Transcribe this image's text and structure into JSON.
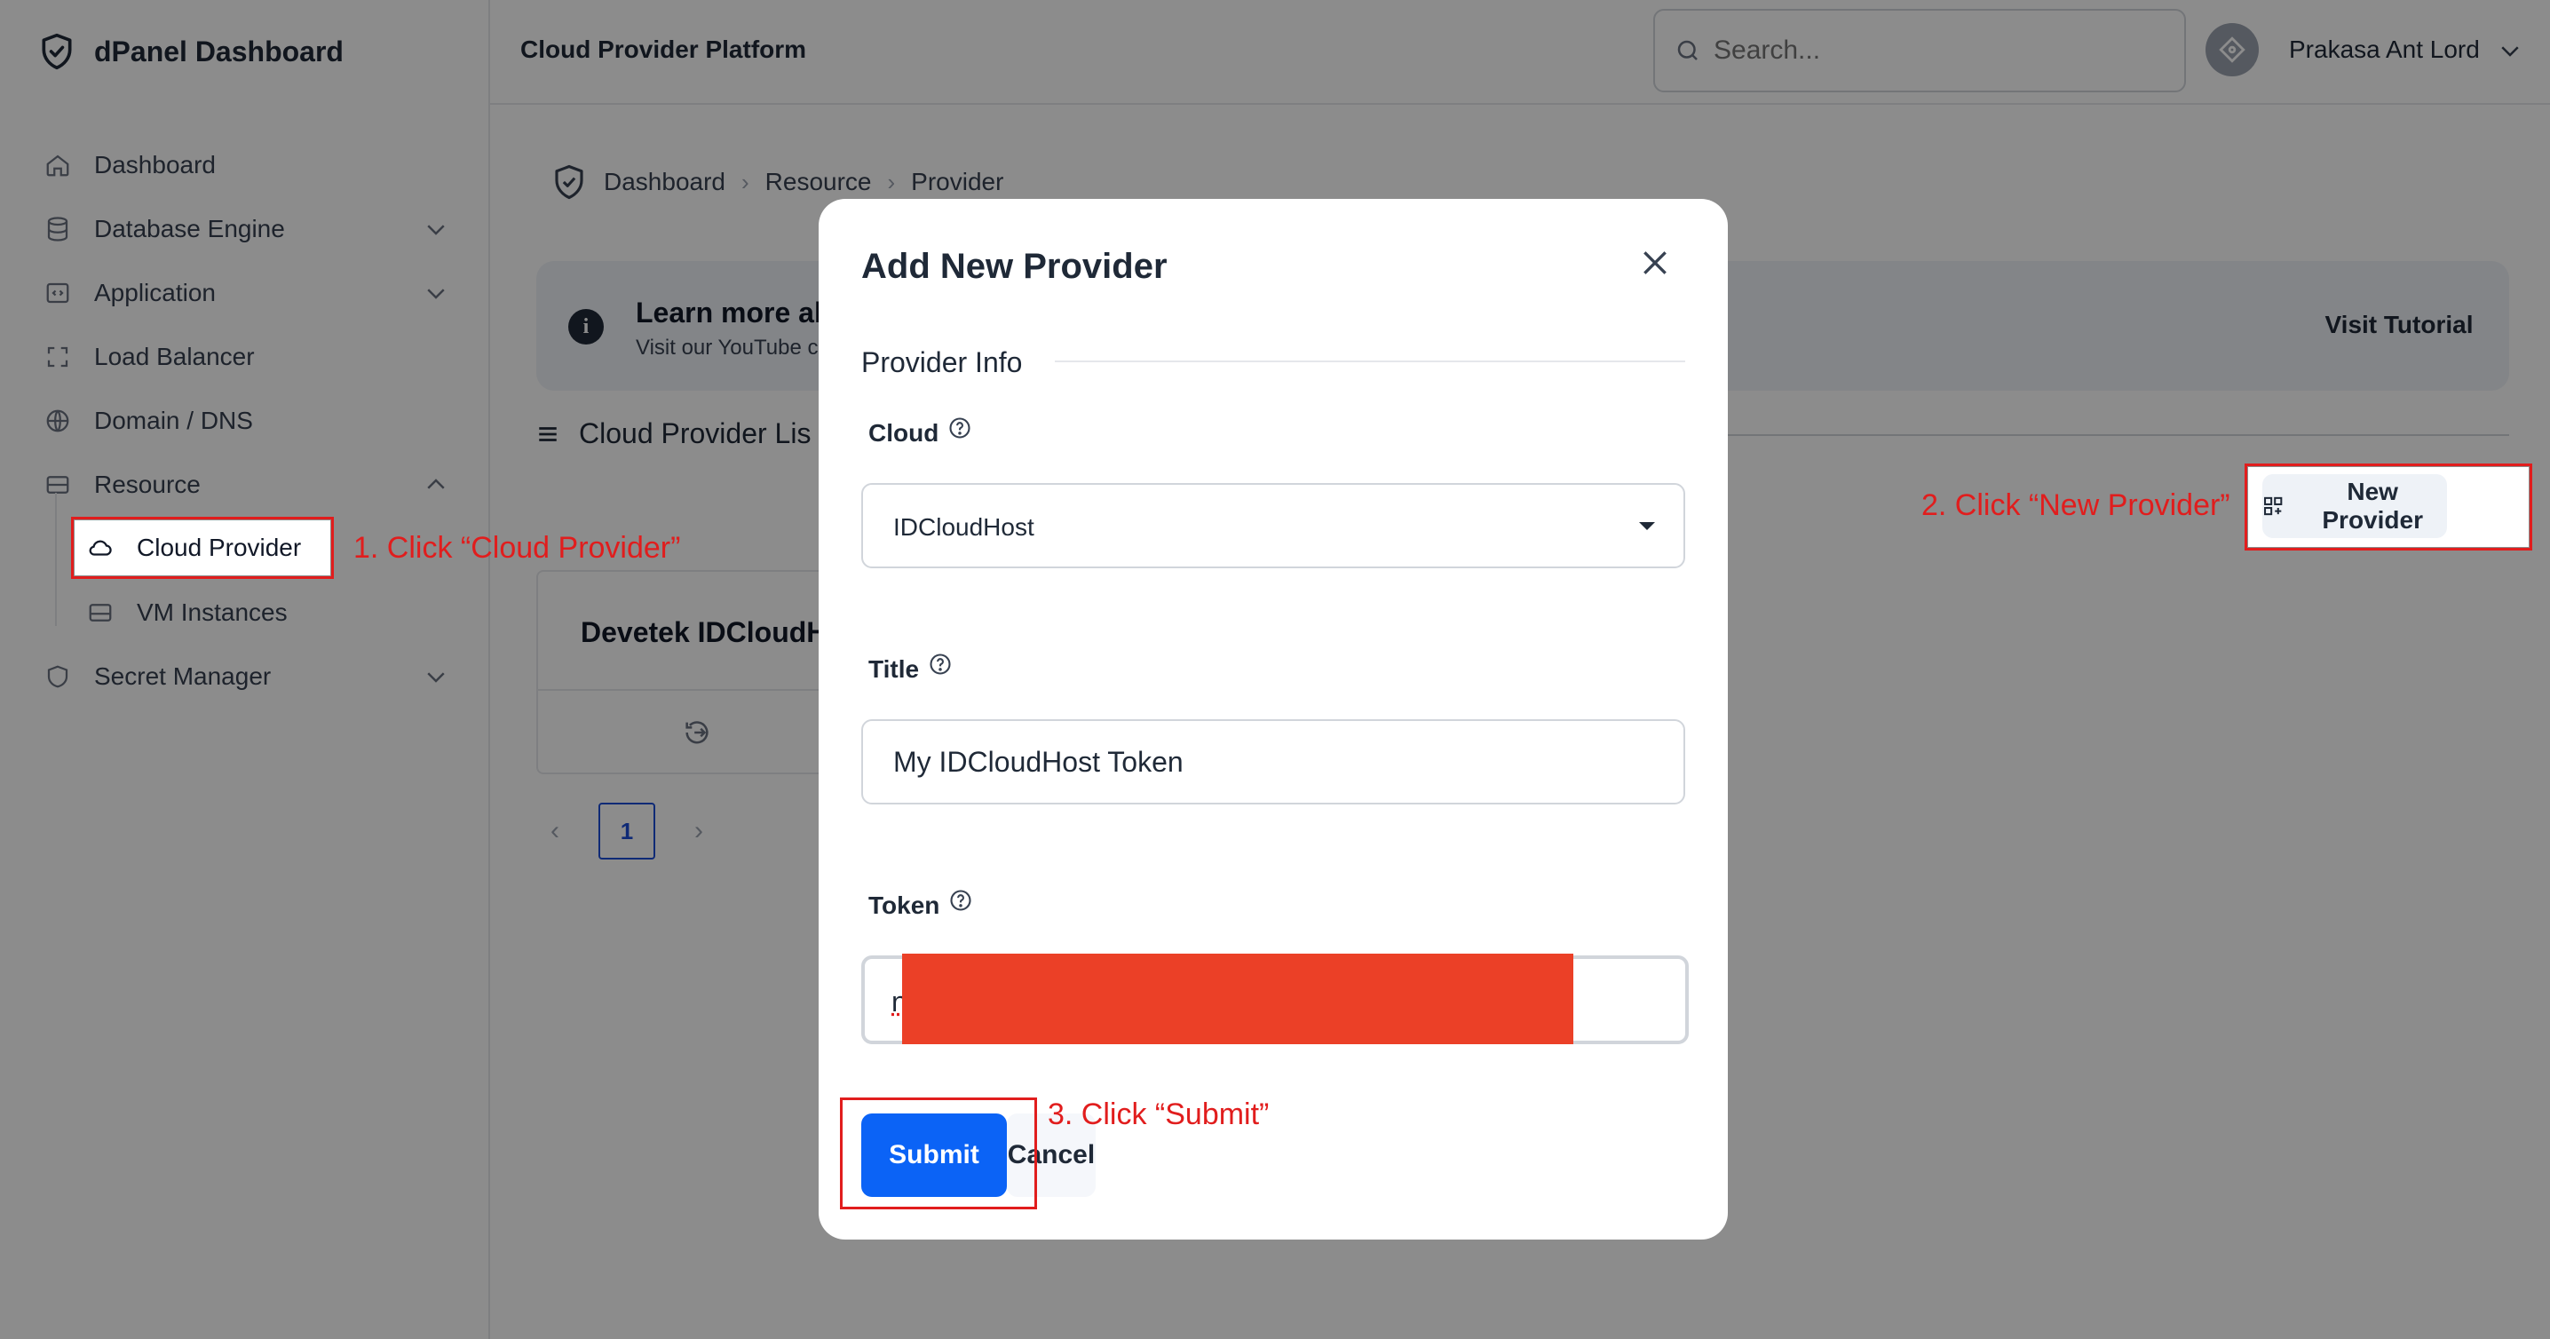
{
  "brand": {
    "title": "dPanel Dashboard",
    "icon": "shield-check-icon"
  },
  "topbar": {
    "title": "Cloud Provider Platform",
    "search_placeholder": "Search...",
    "user_name": "Prakasa Ant Lord"
  },
  "sidebar": {
    "items": [
      {
        "label": "Dashboard",
        "icon": "home-icon"
      },
      {
        "label": "Database Engine",
        "icon": "database-icon"
      },
      {
        "label": "Application",
        "icon": "code-window-icon"
      },
      {
        "label": "Load Balancer",
        "icon": "expand-icon"
      },
      {
        "label": "Domain / DNS",
        "icon": "globe-icon"
      },
      {
        "label": "Resource",
        "icon": "server-icon"
      },
      {
        "label": "Secret Manager",
        "icon": "shield-icon"
      }
    ],
    "resource_children": [
      {
        "label": "Cloud Provider",
        "icon": "cloud-icon"
      },
      {
        "label": "VM Instances",
        "icon": "hard-drive-icon"
      }
    ]
  },
  "breadcrumb": [
    "Dashboard",
    "Resource",
    "Provider"
  ],
  "banner": {
    "title": "Learn more al",
    "subtitle": "Visit our YouTube c",
    "button": "Visit Tutorial"
  },
  "list": {
    "title": "Cloud Provider Lis",
    "new_button": "New Provider",
    "card_title": "Devetek IDCloudH",
    "current_page": "1"
  },
  "modal": {
    "title": "Add New Provider",
    "section": "Provider Info",
    "cloud_label": "Cloud",
    "cloud_value": "IDCloudHost",
    "title_label": "Title",
    "title_value": "My IDCloudHost Token",
    "token_label": "Token",
    "token_value_visible": "n",
    "submit": "Submit",
    "cancel": "Cancel"
  },
  "annotations": {
    "step1": "1. Click “Cloud Provider”",
    "step2": "2. Click “New Provider”",
    "step3": "3. Click “Submit”"
  },
  "colors": {
    "primary": "#0b63f6",
    "annotation_red": "#e11d1d",
    "redaction": "#eb4027",
    "overlay": "rgba(0,0,0,0.45)"
  }
}
